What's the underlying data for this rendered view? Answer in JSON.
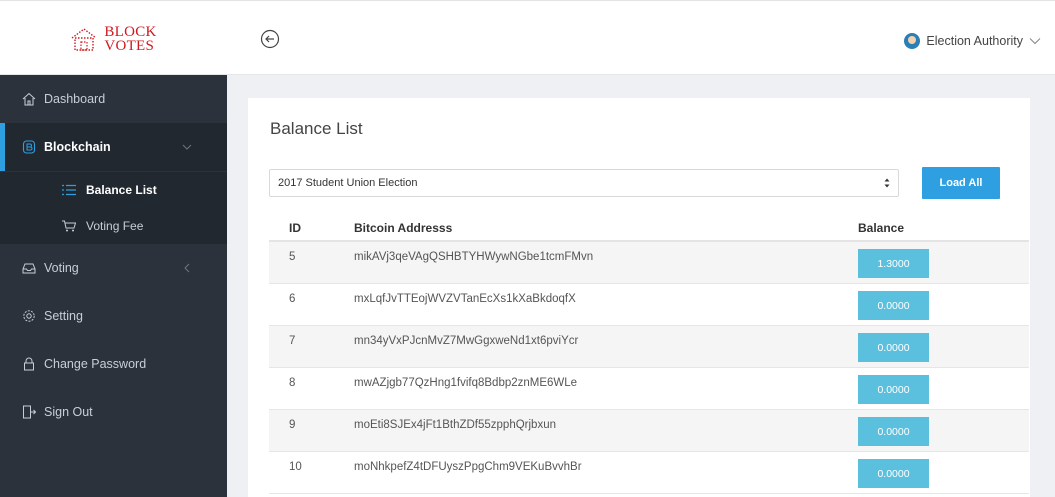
{
  "brand": {
    "line1": "BLOCK",
    "line2": "VOTES",
    "color": "#d0181f"
  },
  "header": {
    "back_icon": "circle-arrow-left-icon",
    "user_name": "Election Authority"
  },
  "sidebar": {
    "items": [
      {
        "label": "Dashboard",
        "icon": "home-icon"
      },
      {
        "label": "Blockchain",
        "icon": "bitcoin-icon"
      },
      {
        "label": "Voting",
        "icon": "inbox-icon"
      },
      {
        "label": "Setting",
        "icon": "gear-icon"
      },
      {
        "label": "Change Password",
        "icon": "lock-icon"
      },
      {
        "label": "Sign Out",
        "icon": "sign-out-icon"
      }
    ],
    "subitems": [
      {
        "label": "Balance List",
        "icon": "list-icon"
      },
      {
        "label": "Voting Fee",
        "icon": "cart-icon"
      }
    ],
    "accent": "#2e9fe0"
  },
  "main": {
    "title": "Balance List",
    "election_select": "2017 Student Union Election",
    "load_all_label": "Load All",
    "table": {
      "headers": {
        "id": "ID",
        "address": "Bitcoin Addresss",
        "balance": "Balance"
      },
      "rows": [
        {
          "id": "5",
          "address": "mikAVj3qeVAgQSHBTYHWywNGbe1tcmFMvn",
          "balance": "1.3000"
        },
        {
          "id": "6",
          "address": "mxLqfJvTTEojWVZVTanEcXs1kXaBkdoqfX",
          "balance": "0.0000"
        },
        {
          "id": "7",
          "address": "mn34yVxPJcnMvZ7MwGgxweNd1xt6pviYcr",
          "balance": "0.0000"
        },
        {
          "id": "8",
          "address": "mwAZjgb77QzHng1fvifq8Bdbp2znME6WLe",
          "balance": "0.0000"
        },
        {
          "id": "9",
          "address": "moEti8SJEx4jFt1BthZDf55zpphQrjbxun",
          "balance": "0.0000"
        },
        {
          "id": "10",
          "address": "moNhkpefZ4tDFUyszPpgChm9VEKuBvvhBr",
          "balance": "0.0000"
        }
      ]
    },
    "balance_color": "#5bc0de"
  }
}
